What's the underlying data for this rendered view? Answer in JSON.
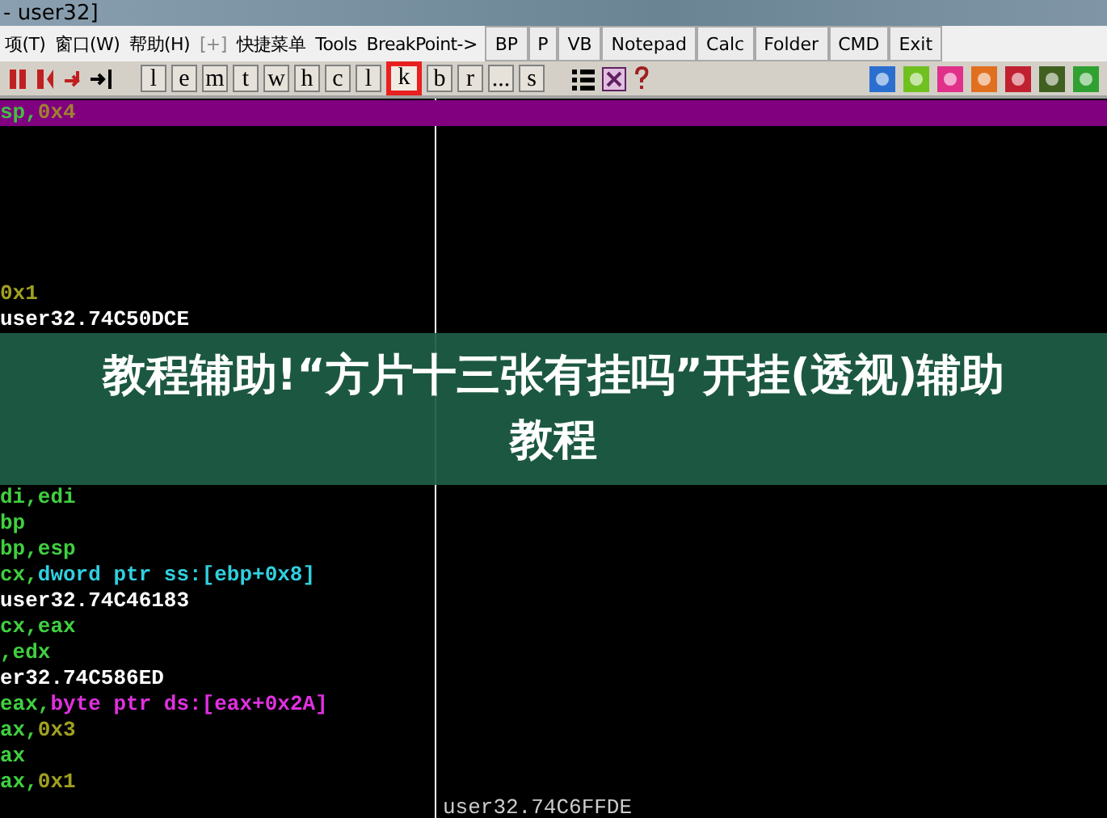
{
  "window": {
    "title": "- user32]"
  },
  "menu": [
    {
      "label": "项(T)",
      "kind": "text"
    },
    {
      "label": "窗口(W)",
      "kind": "text"
    },
    {
      "label": "帮助(H)",
      "kind": "text"
    },
    {
      "label": "[+]",
      "kind": "dim"
    },
    {
      "label": "快捷菜单",
      "kind": "text"
    },
    {
      "label": "Tools",
      "kind": "text"
    },
    {
      "label": "BreakPoint->",
      "kind": "text"
    }
  ],
  "plugin_buttons": [
    "BP",
    "P",
    "VB",
    "Notepad",
    "Calc",
    "Folder",
    "CMD",
    "Exit"
  ],
  "letter_buttons": [
    {
      "label": "l",
      "highlighted": false
    },
    {
      "label": "e",
      "highlighted": false
    },
    {
      "label": "m",
      "highlighted": false
    },
    {
      "label": "t",
      "highlighted": false
    },
    {
      "label": "w",
      "highlighted": false
    },
    {
      "label": "h",
      "highlighted": false
    },
    {
      "label": "c",
      "highlighted": false
    },
    {
      "label": "l",
      "highlighted": false
    },
    {
      "label": "k",
      "highlighted": true
    },
    {
      "label": "b",
      "highlighted": false
    },
    {
      "label": "r",
      "highlighted": false
    },
    {
      "label": "...",
      "highlighted": false
    },
    {
      "label": "s",
      "highlighted": false
    }
  ],
  "code_top": [
    {
      "selected": true,
      "tokens": [
        {
          "text": "sp,",
          "color": "#40c040"
        },
        {
          "text": "0x4",
          "color": "#a08030"
        }
      ]
    },
    {
      "selected": false
    },
    {
      "selected": false
    },
    {
      "selected": false
    },
    {
      "selected": false
    },
    {
      "selected": false
    },
    {
      "selected": false
    },
    {
      "selected": false,
      "tokens": [
        {
          "text": "0x1",
          "color": "#a0a020"
        }
      ]
    },
    {
      "selected": false,
      "tokens": [
        {
          "text": "user32.74C50DCE",
          "color": "#ffffff"
        }
      ]
    }
  ],
  "banner": {
    "text": "教程辅助!“方片十三张有挂吗”开挂(透视)辅助教程"
  },
  "code_bottom": [
    {
      "selected": false,
      "tokens": [
        {
          "text": "di,edi",
          "color": "#40d040"
        }
      ]
    },
    {
      "selected": false,
      "tokens": [
        {
          "text": "bp",
          "color": "#40d040"
        }
      ]
    },
    {
      "selected": false,
      "tokens": [
        {
          "text": "bp,esp",
          "color": "#40d040"
        }
      ]
    },
    {
      "selected": false,
      "tokens": [
        {
          "text": "cx,",
          "color": "#40d040"
        },
        {
          "text": "dword ptr ss:[ebp+0x8]",
          "color": "#30d0e0"
        }
      ]
    },
    {
      "selected": false,
      "tokens": [
        {
          "text": "user32.74C46183",
          "color": "#ffffff"
        }
      ]
    },
    {
      "selected": false,
      "tokens": [
        {
          "text": "cx,eax",
          "color": "#40d040"
        }
      ]
    },
    {
      "selected": false,
      "tokens": [
        {
          "text": ",edx",
          "color": "#40d040"
        }
      ]
    },
    {
      "selected": false,
      "tokens": [
        {
          "text": "er32.74C586ED",
          "color": "#ffffff"
        }
      ]
    },
    {
      "selected": false,
      "tokens": [
        {
          "text": "eax,",
          "color": "#40d040"
        },
        {
          "text": "byte ptr ds:[eax+0x2A]",
          "color": "#e030e0"
        }
      ]
    },
    {
      "selected": false,
      "tokens": [
        {
          "text": "ax,",
          "color": "#40d040"
        },
        {
          "text": "0x3",
          "color": "#a0a020"
        }
      ]
    },
    {
      "selected": false,
      "tokens": [
        {
          "text": "ax",
          "color": "#40d040"
        }
      ]
    },
    {
      "selected": false,
      "tokens": [
        {
          "text": "ax,",
          "color": "#40d040"
        },
        {
          "text": "0x1",
          "color": "#a0a020"
        }
      ]
    }
  ],
  "comment": {
    "text": "user32.74C6FFDE"
  }
}
